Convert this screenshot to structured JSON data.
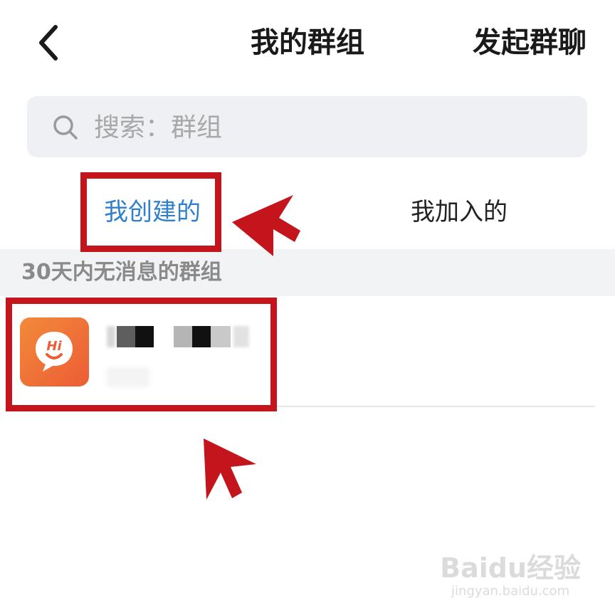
{
  "nav": {
    "back_icon": "chevron-left-icon",
    "title": "我的群组",
    "action_label": "发起群聊"
  },
  "search": {
    "icon": "search-icon",
    "placeholder": "搜索：群组",
    "value": ""
  },
  "tabs": [
    {
      "label": "我创建的",
      "selected": true
    },
    {
      "label": "我加入的",
      "selected": false
    }
  ],
  "section": {
    "title": "30天内无消息的群组"
  },
  "groups": [
    {
      "avatar_text": "Hi",
      "avatar_icon": "chat-bubble-icon"
    }
  ],
  "colors": {
    "accent": "#2f7fcf",
    "annotation": "#c4151c",
    "avatar_from": "#f28a3a",
    "avatar_to": "#ec5c35"
  },
  "watermark": {
    "logo": "Baidu经验",
    "url": "jingyan.baidu.com"
  }
}
